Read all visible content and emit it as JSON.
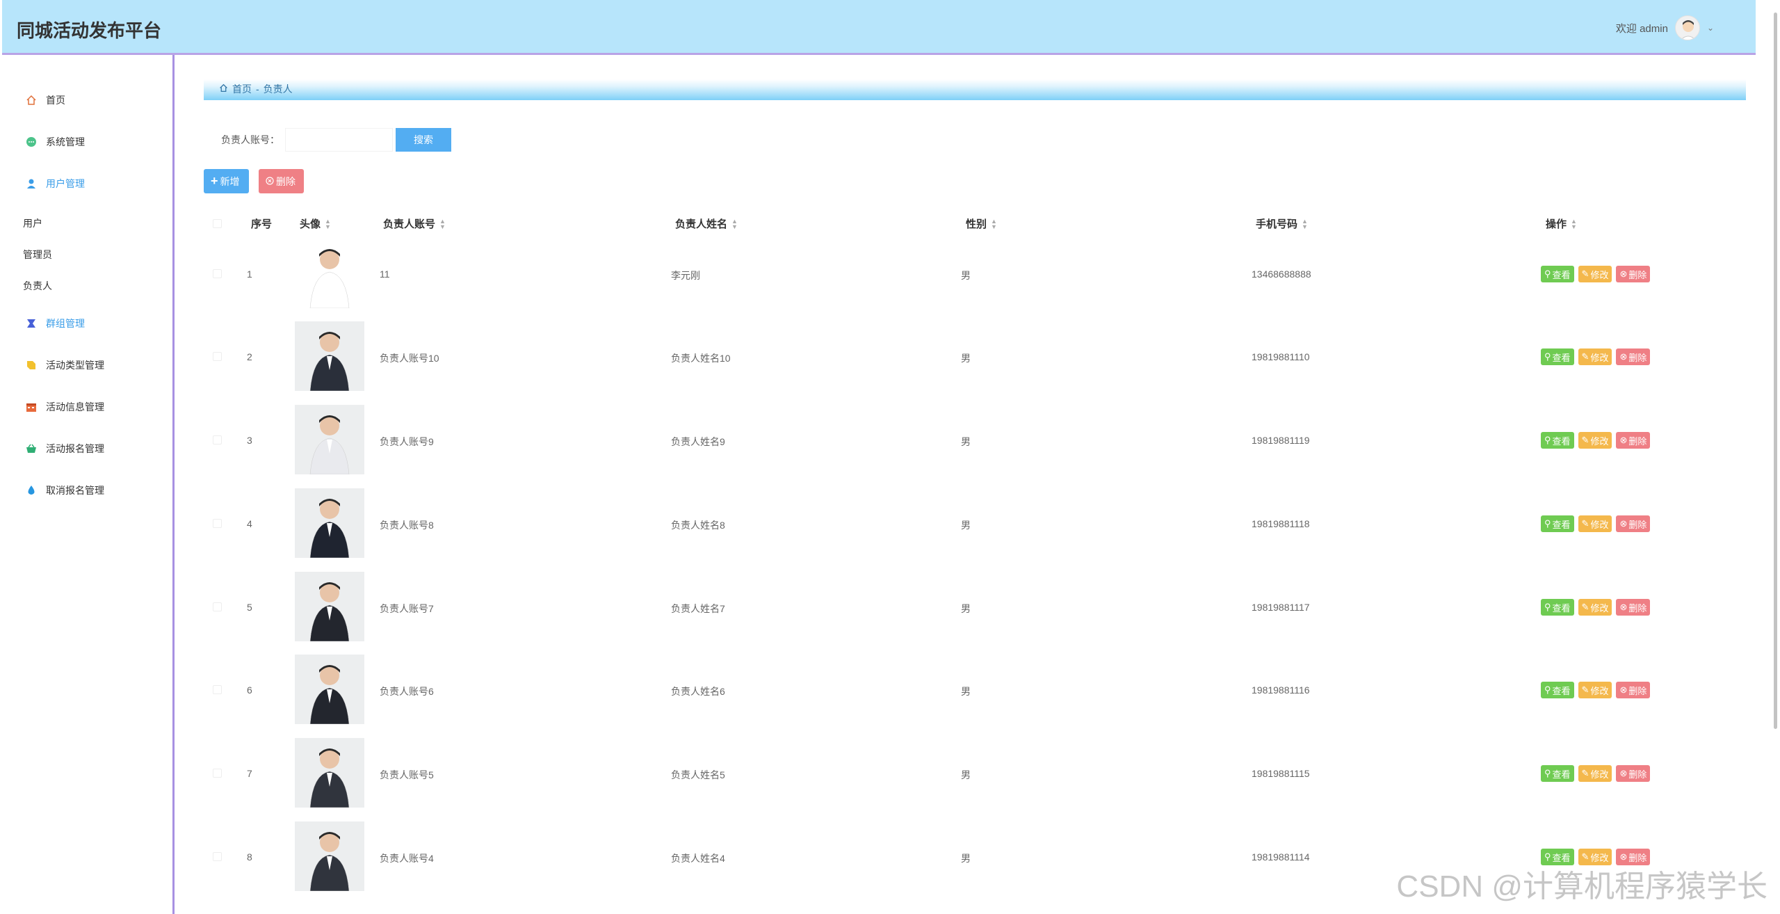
{
  "header": {
    "title": "同城活动发布平台",
    "welcome": "欢迎 admin"
  },
  "sidebar": {
    "items": [
      {
        "label": "首页",
        "icon": "home-icon"
      },
      {
        "label": "系统管理",
        "icon": "chat-icon"
      },
      {
        "label": "用户管理",
        "icon": "user-icon"
      },
      {
        "label": "群组管理",
        "icon": "group-icon"
      },
      {
        "label": "活动类型管理",
        "icon": "tag-icon"
      },
      {
        "label": "活动信息管理",
        "icon": "calendar-icon"
      },
      {
        "label": "活动报名管理",
        "icon": "basket-icon"
      },
      {
        "label": "取消报名管理",
        "icon": "drop-icon"
      }
    ],
    "sub_items": [
      "用户",
      "管理员",
      "负责人"
    ]
  },
  "breadcrumb": {
    "home": "首页",
    "sep": "-",
    "current": "负责人"
  },
  "search": {
    "label": "负责人账号：",
    "value": "",
    "button": "搜索"
  },
  "actions": {
    "add": "新增",
    "delete": "删除"
  },
  "table": {
    "headers": {
      "index": "序号",
      "avatar": "头像",
      "account": "负责人账号",
      "name": "负责人姓名",
      "gender": "性别",
      "phone": "手机号码",
      "ops": "操作"
    },
    "ops": {
      "view": "查看",
      "edit": "修改",
      "remove": "删除"
    },
    "rows": [
      {
        "index": "1",
        "account": "11",
        "name": "李元刚",
        "gender": "男",
        "phone": "13468688888"
      },
      {
        "index": "2",
        "account": "负责人账号10",
        "name": "负责人姓名10",
        "gender": "男",
        "phone": "19819881110"
      },
      {
        "index": "3",
        "account": "负责人账号9",
        "name": "负责人姓名9",
        "gender": "男",
        "phone": "19819881119"
      },
      {
        "index": "4",
        "account": "负责人账号8",
        "name": "负责人姓名8",
        "gender": "男",
        "phone": "19819881118"
      },
      {
        "index": "5",
        "account": "负责人账号7",
        "name": "负责人姓名7",
        "gender": "男",
        "phone": "19819881117"
      },
      {
        "index": "6",
        "account": "负责人账号6",
        "name": "负责人姓名6",
        "gender": "男",
        "phone": "19819881116"
      },
      {
        "index": "7",
        "account": "负责人账号5",
        "name": "负责人姓名5",
        "gender": "男",
        "phone": "19819881115"
      },
      {
        "index": "8",
        "account": "负责人账号4",
        "name": "负责人姓名4",
        "gender": "男",
        "phone": "19819881114"
      }
    ]
  },
  "watermark": "CSDN @计算机程序猿学长"
}
